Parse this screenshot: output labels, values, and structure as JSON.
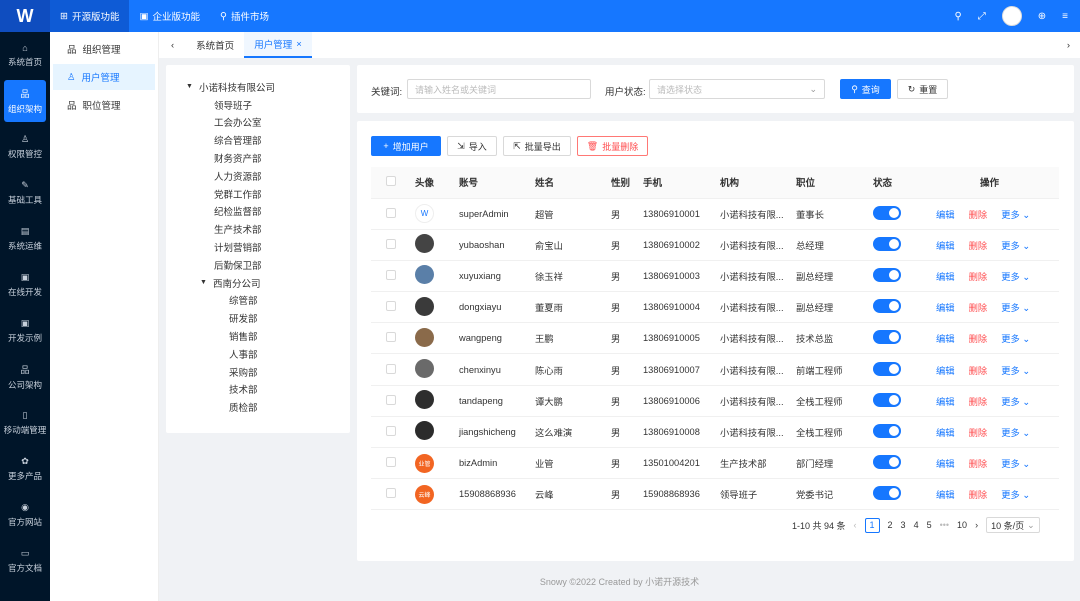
{
  "topbar": {
    "logo": "W",
    "tabs": [
      {
        "label": "开源版功能",
        "icon": "grid-icon"
      },
      {
        "label": "企业版功能",
        "icon": "building-icon"
      },
      {
        "label": "插件市场",
        "icon": "link-icon"
      }
    ]
  },
  "leftnav": {
    "items": [
      {
        "label": "系统首页",
        "icon": "⌂"
      },
      {
        "label": "组织架构",
        "icon": "品"
      },
      {
        "label": "权限管控",
        "icon": "♙"
      },
      {
        "label": "基础工具",
        "icon": "✎"
      },
      {
        "label": "系统运维",
        "icon": "▤"
      },
      {
        "label": "在线开发",
        "icon": "▣"
      },
      {
        "label": "开发示例",
        "icon": "▣"
      },
      {
        "label": "公司架构",
        "icon": "品"
      },
      {
        "label": "移动端管理",
        "icon": "▯"
      },
      {
        "label": "更多产品",
        "icon": "✿"
      },
      {
        "label": "官方网站",
        "icon": "◉"
      },
      {
        "label": "官方文档",
        "icon": "▭"
      }
    ]
  },
  "submenu": {
    "items": [
      {
        "label": "组织管理",
        "icon": "品"
      },
      {
        "label": "用户管理",
        "icon": "♙"
      },
      {
        "label": "职位管理",
        "icon": "品"
      }
    ]
  },
  "tabs": {
    "home": "系统首页",
    "current": "用户管理"
  },
  "tree": {
    "root": "小诺科技有限公司",
    "children": [
      "领导班子",
      "工会办公室",
      "综合管理部",
      "财务资产部",
      "人力资源部",
      "党群工作部",
      "纪检监督部",
      "生产技术部",
      "计划营销部",
      "后勤保卫部"
    ],
    "branch": "西南分公司",
    "branch_children": [
      "综管部",
      "研发部",
      "销售部",
      "人事部",
      "采购部",
      "技术部",
      "质检部"
    ]
  },
  "search": {
    "keyword_label": "关键词:",
    "keyword_placeholder": "请输入姓名或关键词",
    "status_label": "用户状态:",
    "status_placeholder": "请选择状态",
    "query": "查询",
    "reset": "重置"
  },
  "toolbar": {
    "add": "增加用户",
    "import": "导入",
    "export": "批量导出",
    "delete": "批量删除"
  },
  "table": {
    "headers": [
      "头像",
      "账号",
      "姓名",
      "性别",
      "手机",
      "机构",
      "职位",
      "状态",
      "操作"
    ],
    "ops": {
      "edit": "编辑",
      "delete": "删除",
      "more": "更多"
    },
    "rows": [
      {
        "avatar": "logo",
        "account": "superAdmin",
        "name": "超管",
        "gender": "男",
        "phone": "13806910001",
        "org": "小诺科技有限...",
        "position": "董事长"
      },
      {
        "avatar": "photo",
        "account": "yubaoshan",
        "name": "俞宝山",
        "gender": "男",
        "phone": "13806910002",
        "org": "小诺科技有限...",
        "position": "总经理"
      },
      {
        "avatar": "photo",
        "account": "xuyuxiang",
        "name": "徐玉祥",
        "gender": "男",
        "phone": "13806910003",
        "org": "小诺科技有限...",
        "position": "副总经理"
      },
      {
        "avatar": "photo",
        "account": "dongxiayu",
        "name": "董夏雨",
        "gender": "男",
        "phone": "13806910004",
        "org": "小诺科技有限...",
        "position": "副总经理"
      },
      {
        "avatar": "photo",
        "account": "wangpeng",
        "name": "王鹏",
        "gender": "男",
        "phone": "13806910005",
        "org": "小诺科技有限...",
        "position": "技术总监"
      },
      {
        "avatar": "photo",
        "account": "chenxinyu",
        "name": "陈心雨",
        "gender": "男",
        "phone": "13806910007",
        "org": "小诺科技有限...",
        "position": "前端工程师"
      },
      {
        "avatar": "photo",
        "account": "tandapeng",
        "name": "谭大鹏",
        "gender": "男",
        "phone": "13806910006",
        "org": "小诺科技有限...",
        "position": "全栈工程师"
      },
      {
        "avatar": "photo",
        "account": "jiangshicheng",
        "name": "这么难演",
        "gender": "男",
        "phone": "13806910008",
        "org": "小诺科技有限...",
        "position": "全栈工程师"
      },
      {
        "avatar": "业管",
        "account": "bizAdmin",
        "name": "业管",
        "gender": "男",
        "phone": "13501004201",
        "org": "生产技术部",
        "position": "部门经理"
      },
      {
        "avatar": "云峰",
        "account": "15908868936",
        "name": "云峰",
        "gender": "男",
        "phone": "15908868936",
        "org": "领导班子",
        "position": "党委书记"
      }
    ]
  },
  "pagination": {
    "total": "1-10 共 94 条",
    "pages": [
      "1",
      "2",
      "3",
      "4",
      "5",
      "10"
    ],
    "ellipsis": "•••",
    "size": "10 条/页"
  },
  "footer": "Snowy ©2022 Created by 小诺开源技术",
  "colors": {
    "primary": "#1677ff",
    "danger": "#ff4d4f",
    "nav_bg": "#001529"
  }
}
